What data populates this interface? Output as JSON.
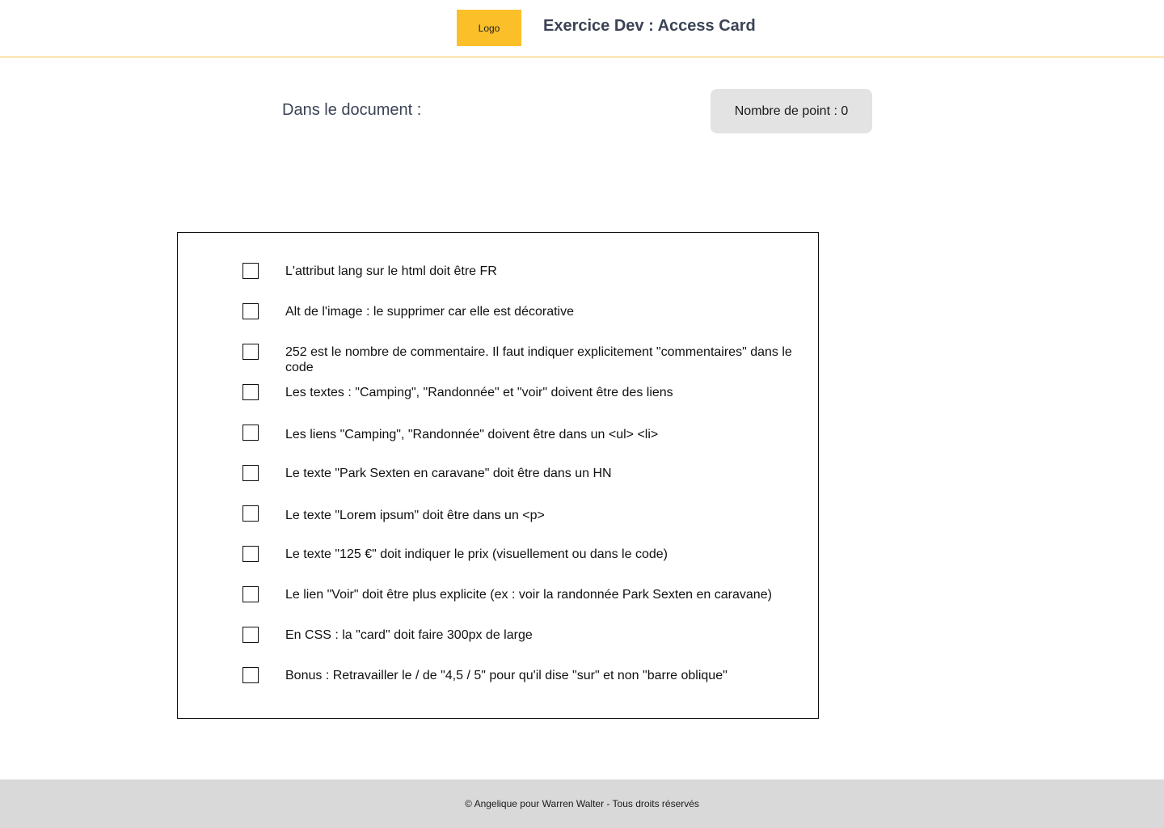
{
  "header": {
    "logo_text": "Logo",
    "title": "Exercice Dev : Access Card",
    "accent_color": "#fbbf2a",
    "border_color": "#f4c24a"
  },
  "summary": {
    "document_label": "Dans le document :",
    "points_label": "Nombre de point : 0"
  },
  "checklist": {
    "items": [
      {
        "label": "L'attribut lang sur le html doit être FR",
        "checked": false
      },
      {
        "label": "Alt de l'image : le supprimer car elle est décorative",
        "checked": false
      },
      {
        "label": "252 est le nombre de commentaire. Il faut indiquer explicitement \"commentaires\" dans le code",
        "checked": false
      },
      {
        "label": "Les textes : \"Camping\", \"Randonnée\" et \"voir\" doivent être des liens",
        "checked": false
      },
      {
        "label": "Les liens \"Camping\", \"Randonnée\" doivent être dans un <ul> <li>",
        "checked": false
      },
      {
        "label": "Le texte \"Park Sexten en caravane\" doit être dans un HN",
        "checked": false
      },
      {
        "label": "Le texte \"Lorem ipsum\" doit être dans un <p>",
        "checked": false
      },
      {
        "label": "Le texte \"125 €\" doit indiquer le prix (visuellement ou dans le code)",
        "checked": false
      },
      {
        "label": "Le lien \"Voir\" doit être plus explicite (ex : voir la randonnée Park Sexten en caravane)",
        "checked": false
      },
      {
        "label": "En CSS : la \"card\" doit faire 300px de large",
        "checked": false
      },
      {
        "label": "Bonus : Retravailler le / de \"4,5 / 5\" pour qu'il dise \"sur\" et non \"barre oblique\"",
        "checked": false
      }
    ]
  },
  "footer": {
    "text": "© Angelique pour Warren Walter - Tous droits réservés"
  }
}
